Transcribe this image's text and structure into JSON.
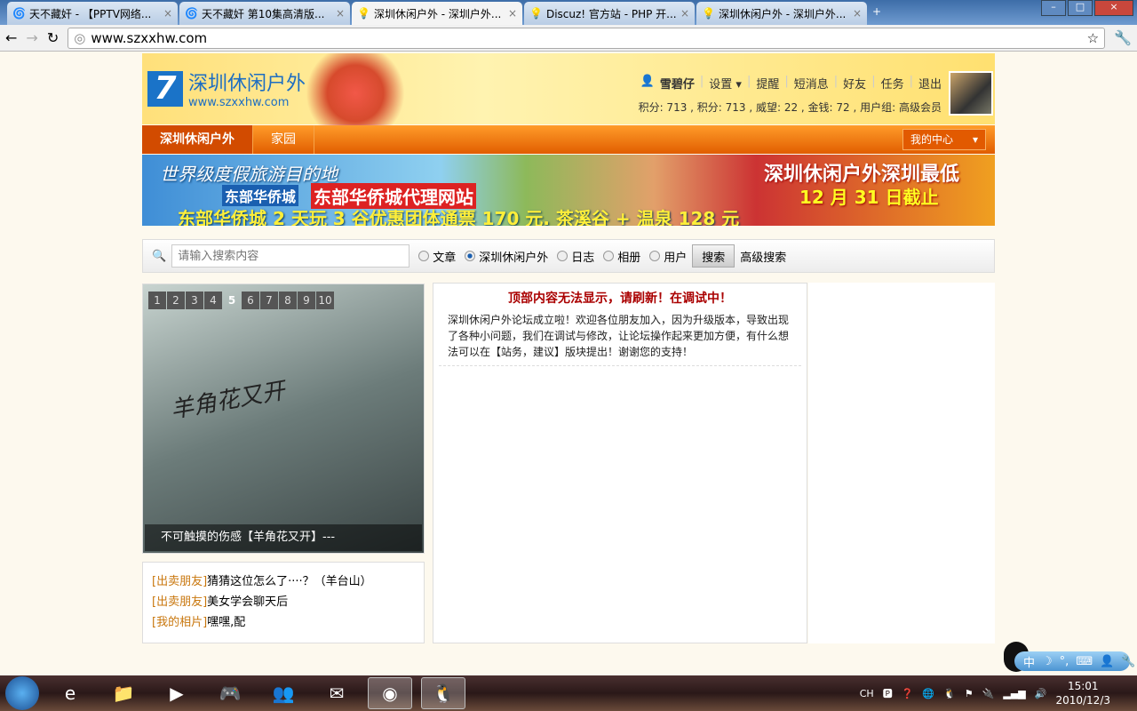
{
  "browser": {
    "tabs": [
      {
        "title": "天不藏奸 - 【PPTV网络...",
        "active": false
      },
      {
        "title": "天不藏奸 第10集高清版...",
        "active": false
      },
      {
        "title": "深圳休闲户外 - 深圳户外...",
        "active": true
      },
      {
        "title": "Discuz! 官方站 - PHP 开...",
        "active": false
      },
      {
        "title": "深圳休闲户外 - 深圳户外...",
        "active": false
      }
    ],
    "url": "www.szxxhw.com"
  },
  "header": {
    "logo_name": "深圳休闲户外",
    "logo_url": "www.szxxhw.com",
    "user": "雪碧仔",
    "menu": [
      "设置",
      "提醒",
      "短消息",
      "好友",
      "任务",
      "退出"
    ],
    "stats": "积分: 713 , 积分: 713 , 威望: 22 , 金钱: 72 , 用户组: 高级会员"
  },
  "nav": {
    "items": [
      "深圳休闲户外",
      "家园"
    ],
    "my_center": "我的中心"
  },
  "banner": {
    "line1": "世界级度假旅游目的地",
    "line2": "东部华侨城",
    "line3": "东部华侨城代理网站",
    "line4": "东部华侨城 2 天玩 3 谷优惠团体通票 170 元. 茶溪谷 + 温泉 128 元",
    "line5": "深圳休闲户外深圳最低",
    "line6": "12 月 31 日截止"
  },
  "search": {
    "placeholder": "请输入搜索内容",
    "options": [
      "文章",
      "深圳休闲户外",
      "日志",
      "相册",
      "用户"
    ],
    "selected": "深圳休闲户外",
    "button": "搜索",
    "advanced": "高级搜索"
  },
  "slideshow": {
    "pages": [
      "1",
      "2",
      "3",
      "4",
      "5",
      "6",
      "7",
      "8",
      "9",
      "10"
    ],
    "current": "5",
    "art_title": "羊角花又开",
    "caption": "不可触摸的伤感【羊角花又开】---"
  },
  "links": [
    {
      "tag": "[出卖朋友]",
      "text": "猜猜这位怎么了····？（羊台山）"
    },
    {
      "tag": "[出卖朋友]",
      "text": "美女学会聊天后"
    },
    {
      "tag": "[我的相片]",
      "text": "嘿嘿,配"
    }
  ],
  "notice": {
    "title": "顶部内容无法显示，请刷新！在调试中！",
    "body": "深圳休闲户外论坛成立啦！欢迎各位朋友加入，因为升级版本，导致出现了各种小问题，我们在调试与修改，让论坛操作起来更加方便，有什么想法可以在【站务，建议】版块提出！谢谢您的支持！"
  },
  "ime": {
    "label": "中"
  },
  "tray": {
    "lang": "CH",
    "time": "15:01",
    "date": "2010/12/3"
  }
}
